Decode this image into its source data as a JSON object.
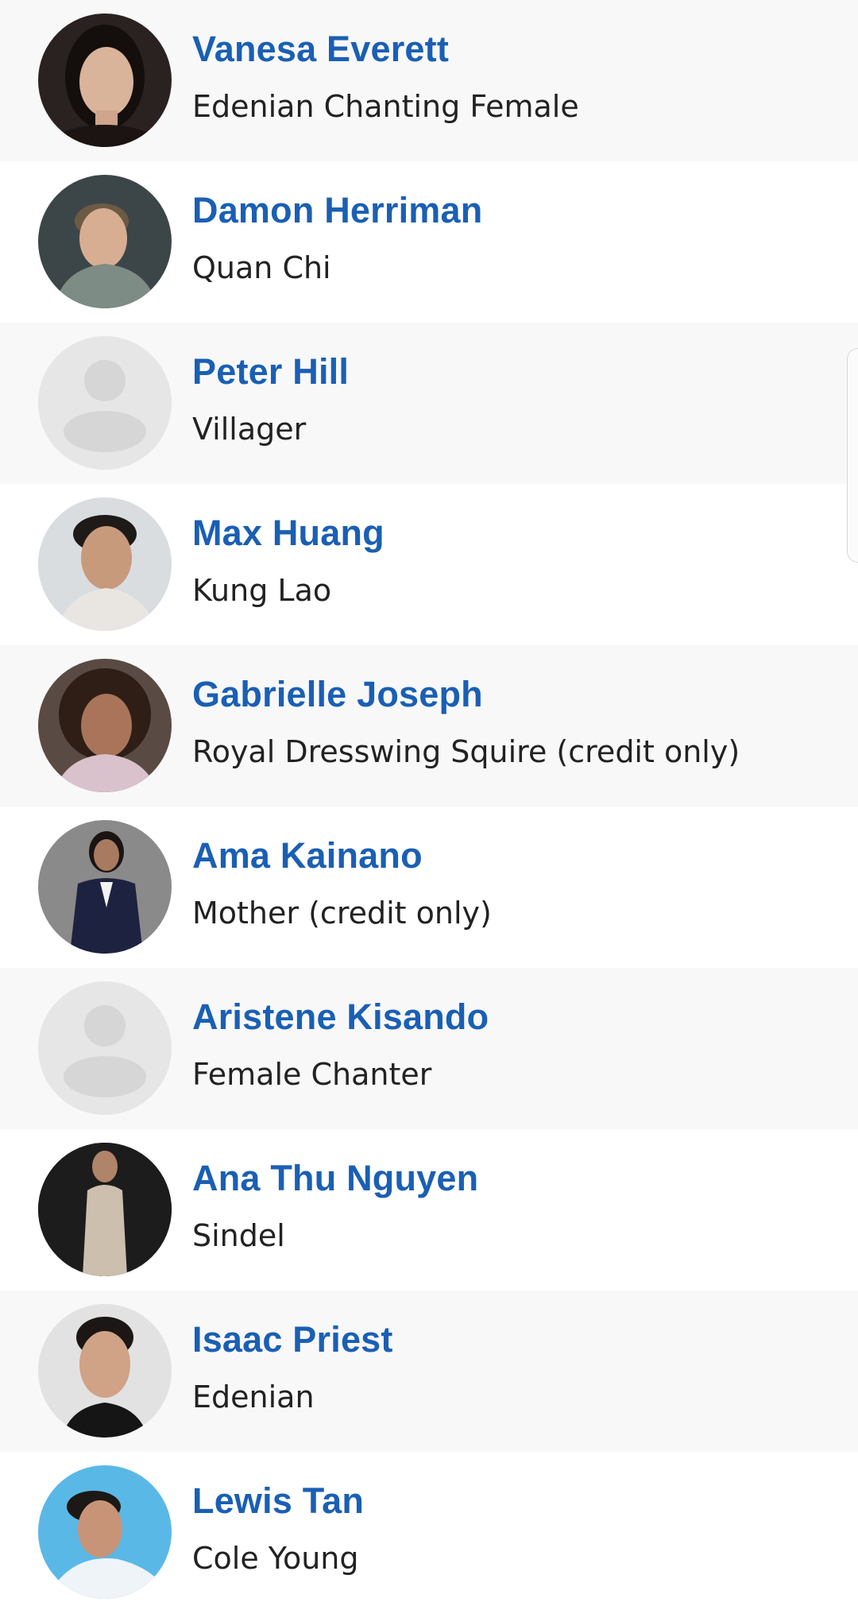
{
  "colors": {
    "name_link": "#1a5fb4",
    "role_text": "#222222",
    "row_shaded": "#f8f8f8",
    "row_plain": "#ffffff",
    "placeholder_avatar": "#e6e6e6"
  },
  "cast": [
    {
      "actor": "Vanesa Everett",
      "character": "Edenian Chanting Female",
      "avatar_icon": "headshot-photo"
    },
    {
      "actor": "Damon Herriman",
      "character": "Quan Chi",
      "avatar_icon": "headshot-photo"
    },
    {
      "actor": "Peter Hill",
      "character": "Villager",
      "avatar_icon": "person-placeholder-icon"
    },
    {
      "actor": "Max Huang",
      "character": "Kung Lao",
      "avatar_icon": "headshot-photo"
    },
    {
      "actor": "Gabrielle Joseph",
      "character": "Royal Dresswing Squire (credit only)",
      "avatar_icon": "headshot-photo"
    },
    {
      "actor": "Ama Kainano",
      "character": "Mother (credit only)",
      "avatar_icon": "headshot-photo"
    },
    {
      "actor": "Aristene Kisando",
      "character": "Female Chanter",
      "avatar_icon": "person-placeholder-icon"
    },
    {
      "actor": "Ana Thu Nguyen",
      "character": "Sindel",
      "avatar_icon": "headshot-photo"
    },
    {
      "actor": "Isaac Priest",
      "character": "Edenian",
      "avatar_icon": "headshot-photo"
    },
    {
      "actor": "Lewis Tan",
      "character": "Cole Young",
      "avatar_icon": "headshot-photo"
    }
  ]
}
